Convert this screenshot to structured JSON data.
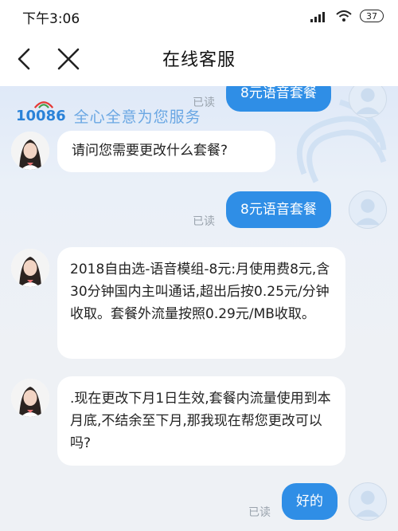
{
  "status": {
    "time": "下午3:06",
    "battery": "37"
  },
  "header": {
    "title": "在线客服"
  },
  "brand": {
    "number": "10086",
    "slogan": "全心全意为您服务"
  },
  "messages": {
    "m0": {
      "text": "8元语音套餐",
      "read": "已读"
    },
    "m1": {
      "text": "请问您需要更改什么套餐?"
    },
    "m2": {
      "text": "8元语音套餐",
      "read": "已读"
    },
    "m3": {
      "text": "2018自由选-语音模组-8元:月使用费8元,含30分钟国内主叫通话,超出后按0.25元/分钟收取。套餐外流量按照0.29元/MB收取。"
    },
    "m4": {
      "text": ".现在更改下月1日生效,套餐内流量使用到本月底,不结余至下月,那我现在帮您更改可以吗?"
    },
    "m5": {
      "text": "好的",
      "read": "已读"
    }
  },
  "colors": {
    "accent": "#2f8ee6",
    "brand": "#2a82d8",
    "read": "#9aa3ad"
  }
}
